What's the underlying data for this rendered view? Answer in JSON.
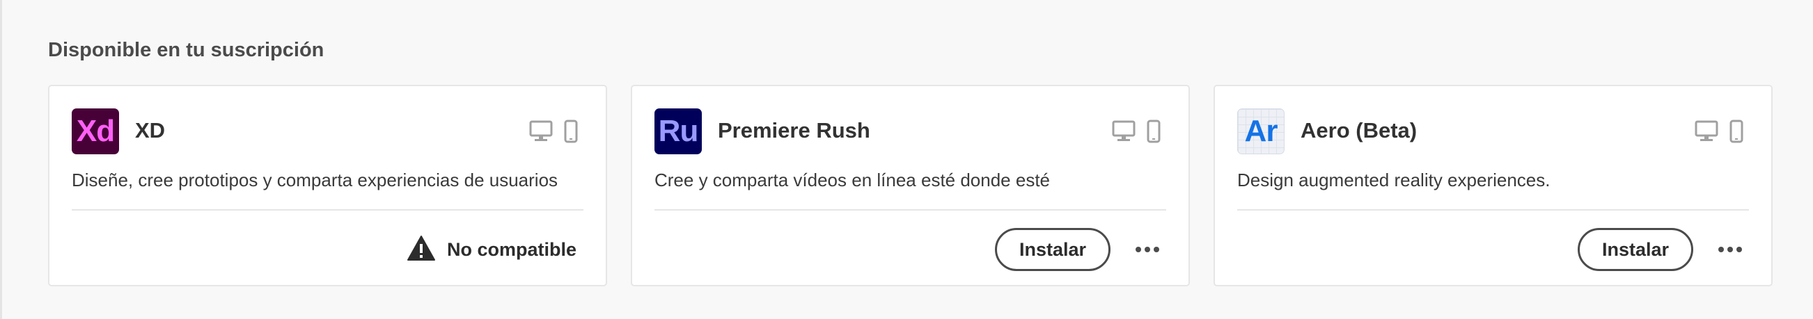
{
  "section": {
    "title": "Disponible en tu suscripción"
  },
  "apps": [
    {
      "icon_text": "Xd",
      "name": "XD",
      "description": "Diseñe, cree prototipos y comparta experiencias de usuarios",
      "platforms": [
        "desktop-icon",
        "mobile-icon"
      ],
      "status": "No compatible"
    },
    {
      "icon_text": "Ru",
      "name": "Premiere Rush",
      "description": "Cree y comparta vídeos en línea esté donde esté",
      "platforms": [
        "desktop-icon",
        "mobile-icon"
      ],
      "install_label": "Instalar"
    },
    {
      "icon_text": "Ar",
      "name": "Aero (Beta)",
      "description": "Design augmented reality experiences.",
      "platforms": [
        "desktop-icon",
        "mobile-icon"
      ],
      "install_label": "Instalar"
    }
  ],
  "colors": {
    "xd_bg": "#470137",
    "xd_fg": "#ff61f6",
    "ru_bg": "#00005b",
    "ru_fg": "#9999ff",
    "ar_bg": "#eef0f5",
    "ar_fg": "#1473e6"
  }
}
